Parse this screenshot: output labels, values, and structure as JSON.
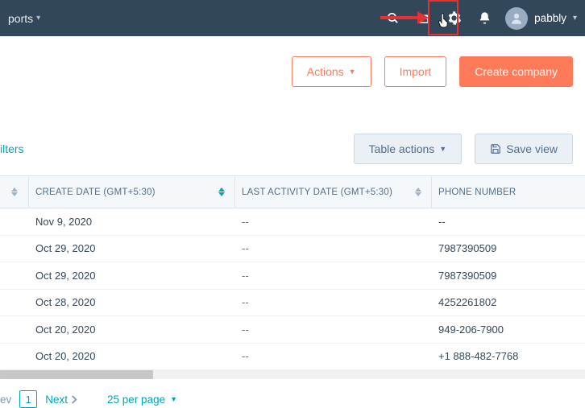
{
  "topbar": {
    "nav_item": "ports",
    "user_label": "pabbly"
  },
  "actions": {
    "actions_label": "Actions",
    "import_label": "Import",
    "create_label": "Create company"
  },
  "midbar": {
    "filters_label": "ilters",
    "table_actions_label": "Table actions",
    "save_view_label": "Save view"
  },
  "table": {
    "columns": {
      "create_date": "CREATE DATE (GMT+5:30)",
      "last_activity": "LAST ACTIVITY DATE (GMT+5:30)",
      "phone": "PHONE NUMBER"
    },
    "rows": [
      {
        "create_date": "Nov 9, 2020",
        "last_activity": "--",
        "phone": "--"
      },
      {
        "create_date": "Oct 29, 2020",
        "last_activity": "--",
        "phone": "7987390509"
      },
      {
        "create_date": "Oct 29, 2020",
        "last_activity": "--",
        "phone": "7987390509"
      },
      {
        "create_date": "Oct 28, 2020",
        "last_activity": "--",
        "phone": "4252261802"
      },
      {
        "create_date": "Oct 20, 2020",
        "last_activity": "--",
        "phone": "949-206-7900"
      },
      {
        "create_date": "Oct 20, 2020",
        "last_activity": "--",
        "phone": "+1 888-482-7768"
      }
    ]
  },
  "pager": {
    "prev_label": "ev",
    "current": "1",
    "next_label": "Next",
    "page_size_label": "25 per page"
  }
}
